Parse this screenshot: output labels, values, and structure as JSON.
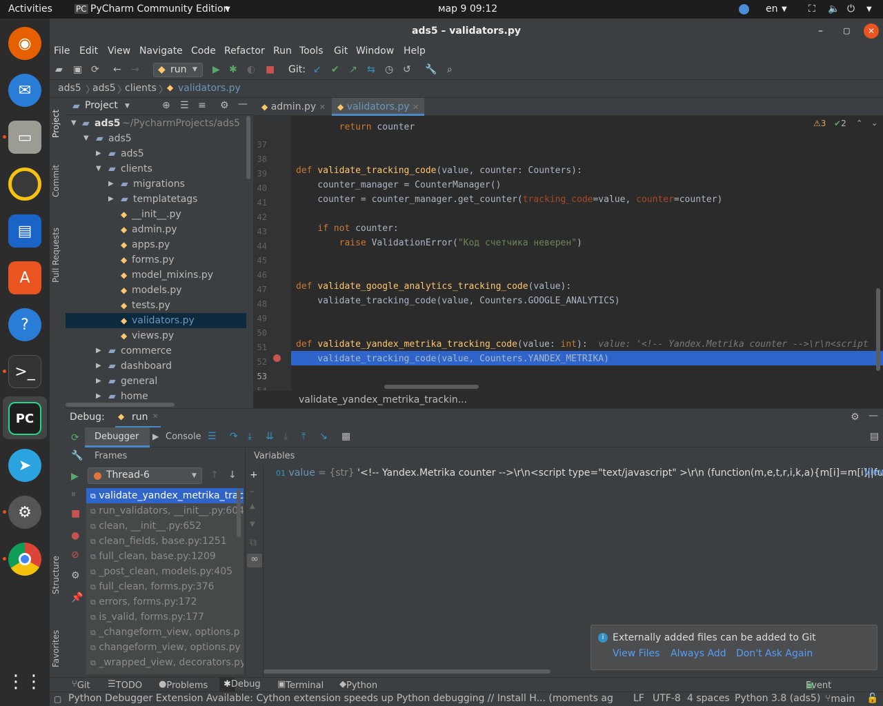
{
  "topbar": {
    "activities": "Activities",
    "app": "PyCharm Community Edition",
    "clock": "мар 9  09:12",
    "lang": "en"
  },
  "window": {
    "title": "ads5 – validators.py"
  },
  "menu": [
    "File",
    "Edit",
    "View",
    "Navigate",
    "Code",
    "Refactor",
    "Run",
    "Tools",
    "Git",
    "Window",
    "Help"
  ],
  "toolbar": {
    "run_config": "run",
    "git_label": "Git:"
  },
  "breadcrumbs": [
    "ads5",
    "ads5",
    "clients",
    "validators.py"
  ],
  "project": {
    "header": "Project",
    "root": "ads5",
    "root_path": "~/PycharmProjects/ads5",
    "items": [
      {
        "label": "ads5",
        "depth": 1,
        "kind": "folder",
        "open": true
      },
      {
        "label": "ads5",
        "depth": 2,
        "kind": "folder",
        "open": false
      },
      {
        "label": "clients",
        "depth": 2,
        "kind": "folder",
        "open": true
      },
      {
        "label": "migrations",
        "depth": 3,
        "kind": "folder",
        "open": false
      },
      {
        "label": "templatetags",
        "depth": 3,
        "kind": "folder",
        "open": false
      },
      {
        "label": "__init__.py",
        "depth": 4,
        "kind": "file"
      },
      {
        "label": "admin.py",
        "depth": 4,
        "kind": "file"
      },
      {
        "label": "apps.py",
        "depth": 4,
        "kind": "file"
      },
      {
        "label": "forms.py",
        "depth": 4,
        "kind": "file"
      },
      {
        "label": "model_mixins.py",
        "depth": 4,
        "kind": "file"
      },
      {
        "label": "models.py",
        "depth": 4,
        "kind": "file"
      },
      {
        "label": "tests.py",
        "depth": 4,
        "kind": "file"
      },
      {
        "label": "validators.py",
        "depth": 4,
        "kind": "file",
        "selected": true
      },
      {
        "label": "views.py",
        "depth": 4,
        "kind": "file"
      },
      {
        "label": "commerce",
        "depth": 2,
        "kind": "folder",
        "open": false
      },
      {
        "label": "dashboard",
        "depth": 2,
        "kind": "folder",
        "open": false
      },
      {
        "label": "general",
        "depth": 2,
        "kind": "folder",
        "open": false
      },
      {
        "label": "home",
        "depth": 2,
        "kind": "folder",
        "open": false
      }
    ]
  },
  "side_tabs": {
    "project": "Project",
    "commit": "Commit",
    "pull_requests": "Pull Requests",
    "structure": "Structure",
    "favorites": "Favorites"
  },
  "editor": {
    "tabs": [
      {
        "label": "admin.py"
      },
      {
        "label": "validators.py",
        "active": true
      }
    ],
    "warnings": "3",
    "weak_warnings": "2",
    "lines": [
      {
        "n": "37",
        "html": "        <span class='kw'>return</span> counter"
      },
      {
        "n": "38",
        "html": ""
      },
      {
        "n": "39",
        "html": ""
      },
      {
        "n": "40",
        "html": "<span class='kw'>def</span> <span class='fn'>validate_tracking_code</span>(value, counter: Counters):"
      },
      {
        "n": "41",
        "html": "    counter_manager = CounterManager()"
      },
      {
        "n": "42",
        "html": "    counter = counter_manager.get_counter(<span class='prm'>tracking_code</span>=value, <span class='prm'>counter</span>=counter)"
      },
      {
        "n": "43",
        "html": ""
      },
      {
        "n": "44",
        "html": "    <span class='kw'>if not</span> counter:"
      },
      {
        "n": "45",
        "html": "        <span class='kw'>raise</span> ValidationError(<span class='str'>\"Код счетчика неверен\"</span>)"
      },
      {
        "n": "46",
        "html": ""
      },
      {
        "n": "47",
        "html": ""
      },
      {
        "n": "48",
        "html": "<span class='kw'>def</span> <span class='fn'>validate_google_analytics_tracking_code</span>(value):"
      },
      {
        "n": "49",
        "html": "    validate_tracking_code(value, Counters.GOOGLE_ANALYTICS)"
      },
      {
        "n": "50",
        "html": ""
      },
      {
        "n": "51",
        "html": ""
      },
      {
        "n": "52",
        "html": "<span class='kw'>def</span> <span class='fn'>validate_yandex_metrika_tracking_code</span>(value: <span class='kw'>int</span>):  <span class='hint'>value: '&lt;!-- Yandex.Metrika counter --&gt;\\r\\n&lt;script</span>"
      },
      {
        "n": "53",
        "html": "    validate_tracking_code(value, Counters.YANDEX_METRIKA)"
      },
      {
        "n": "54",
        "html": ""
      }
    ],
    "crumb": "validate_yandex_metrika_trackin..."
  },
  "debug": {
    "title": "Debug:",
    "config": "run",
    "tab_debugger": "Debugger",
    "tab_console": "Console",
    "frames_label": "Frames",
    "variables_label": "Variables",
    "thread": "Thread-6",
    "frames": [
      "validate_yandex_metrika_trac",
      "run_validators, __init__.py:604",
      "clean, __init__.py:652",
      "clean_fields, base.py:1251",
      "full_clean, base.py:1209",
      "_post_clean, models.py:405",
      "full_clean, forms.py:376",
      "errors, forms.py:172",
      "is_valid, forms.py:177",
      "_changeform_view, options.p",
      "changeform_view, options.py",
      "_wrapped_view, decorators.py"
    ],
    "var_name": "value",
    "var_type": "= {str}",
    "var_value": "'<!-- Yandex.Metrika counter -->\\r\\n<script type=\"text/javascript\" >\\r\\n   (function(m,e,t,r,i,k,a){m[i]=m[i]||fu...",
    "var_view": "View"
  },
  "notification": {
    "text": "Externally added files can be added to Git",
    "action1": "View Files",
    "action2": "Always Add",
    "action3": "Don't Ask Again"
  },
  "bottom_tabs": [
    "Git",
    "TODO",
    "Problems",
    "Debug",
    "Terminal",
    "Python Console"
  ],
  "event_log": "Event Log",
  "status": {
    "message": "Python Debugger Extension Available: Cython extension speeds up Python debugging // Install  H... (moments ago)",
    "lf": "LF",
    "enc": "UTF-8",
    "indent": "4 spaces",
    "interp": "Python 3.8 (ads5)",
    "branch": "main"
  }
}
